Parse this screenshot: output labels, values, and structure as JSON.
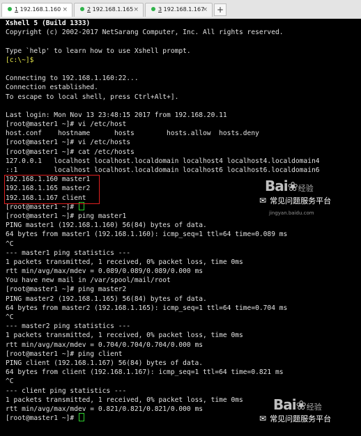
{
  "tabs": [
    {
      "num": "1",
      "host": "192.168.1.160",
      "dot": "#2fb34a",
      "active": true
    },
    {
      "num": "2",
      "host": "192.168.1.165",
      "dot": "#2fb34a",
      "active": false
    },
    {
      "num": "3",
      "host": "192.168.1.167",
      "dot": "#2fb34a",
      "active": false
    }
  ],
  "tab_close": "×",
  "add_tab": "+",
  "terminal": {
    "lines": [
      {
        "t": "Xshell 5 (Build 1333)",
        "c": "bold"
      },
      {
        "t": "Copyright (c) 2002-2017 NetSarang Computer, Inc. All rights reserved."
      },
      {
        "t": ""
      },
      {
        "t": "Type `help' to learn how to use Xshell prompt."
      },
      {
        "t": "[c:\\~]$",
        "c": "yellow"
      },
      {
        "t": ""
      },
      {
        "t": "Connecting to 192.168.1.160:22..."
      },
      {
        "t": "Connection established."
      },
      {
        "t": "To escape to local shell, press Ctrl+Alt+]."
      },
      {
        "t": ""
      },
      {
        "t": "Last login: Mon Nov 13 23:48:15 2017 from 192.168.20.11"
      },
      {
        "t": "[root@master1 ~]# vi /etc/host"
      },
      {
        "t": "host.conf    hostname      hosts        hosts.allow  hosts.deny"
      },
      {
        "t": "[root@master1 ~]# vi /etc/hosts"
      },
      {
        "t": "[root@master1 ~]# cat /etc/hosts"
      },
      {
        "t": "127.0.0.1   localhost localhost.localdomain localhost4 localhost4.localdomain4"
      },
      {
        "t": "::1         localhost localhost.localdomain localhost6 localhost6.localdomain6"
      },
      {
        "t": "192.168.1.160 master1"
      },
      {
        "t": "192.168.1.165 master2"
      },
      {
        "t": "192.168.1.167 client"
      },
      {
        "t": "[root@master1 ~]# ",
        "cursor": true
      },
      {
        "t": "[root@master1 ~]# ping master1"
      },
      {
        "t": "PING master1 (192.168.1.160) 56(84) bytes of data."
      },
      {
        "t": "64 bytes from master1 (192.168.1.160): icmp_seq=1 ttl=64 time=0.089 ms"
      },
      {
        "t": "^C"
      },
      {
        "t": "--- master1 ping statistics ---"
      },
      {
        "t": "1 packets transmitted, 1 received, 0% packet loss, time 0ms"
      },
      {
        "t": "rtt min/avg/max/mdev = 0.089/0.089/0.089/0.000 ms"
      },
      {
        "t": "You have new mail in /var/spool/mail/root"
      },
      {
        "t": "[root@master1 ~]# ping master2"
      },
      {
        "t": "PING master2 (192.168.1.165) 56(84) bytes of data."
      },
      {
        "t": "64 bytes from master2 (192.168.1.165): icmp_seq=1 ttl=64 time=0.704 ms"
      },
      {
        "t": "^C"
      },
      {
        "t": "--- master2 ping statistics ---"
      },
      {
        "t": "1 packets transmitted, 1 received, 0% packet loss, time 0ms"
      },
      {
        "t": "rtt min/avg/max/mdev = 0.704/0.704/0.704/0.000 ms"
      },
      {
        "t": "[root@master1 ~]# ping client"
      },
      {
        "t": "PING client (192.168.1.167) 56(84) bytes of data."
      },
      {
        "t": "64 bytes from client (192.168.1.167): icmp_seq=1 ttl=64 time=0.821 ms"
      },
      {
        "t": "^C"
      },
      {
        "t": "--- client ping statistics ---"
      },
      {
        "t": "1 packets transmitted, 1 received, 0% packet loss, time 0ms"
      },
      {
        "t": "rtt min/avg/max/mdev = 0.821/0.821/0.821/0.000 ms"
      },
      {
        "t": "[root@master1 ~]# ",
        "cursor": true
      }
    ]
  },
  "watermark": {
    "logo": "Bai",
    "logo_cn": "经验",
    "site": "jingyan.baidu.com",
    "caption": "常见问题服务平台"
  }
}
